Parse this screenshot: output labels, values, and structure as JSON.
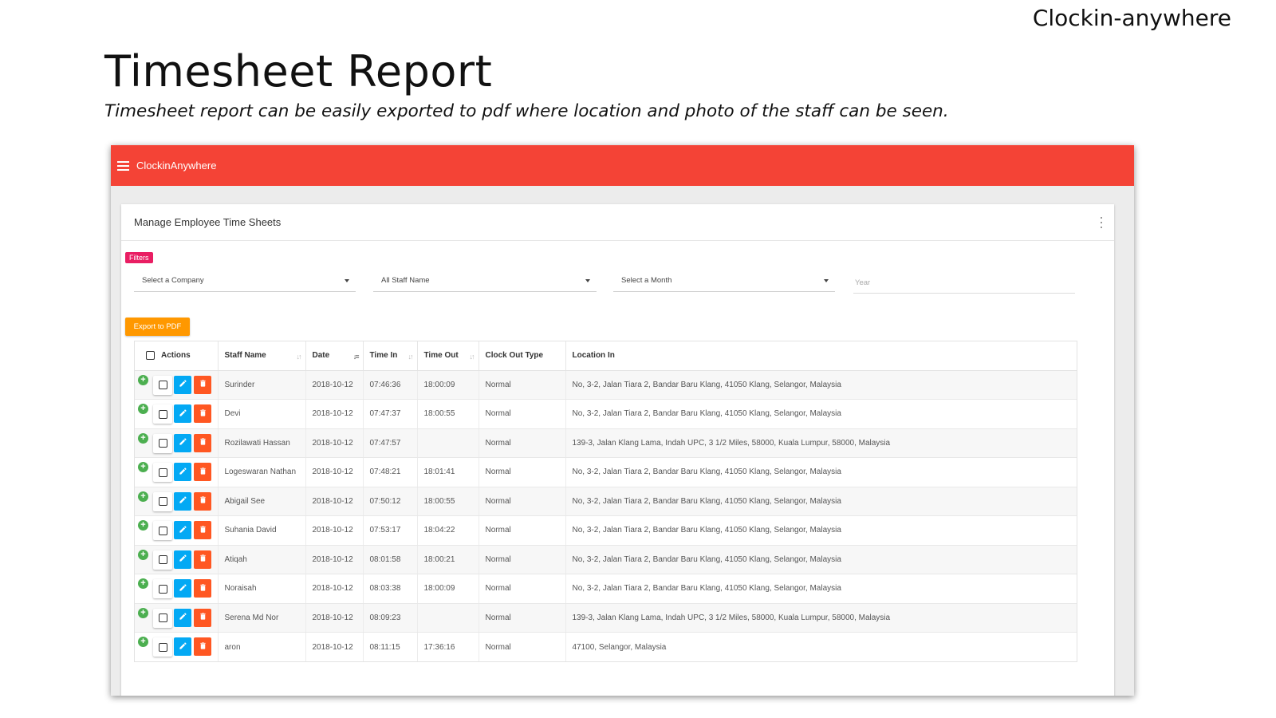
{
  "slide": {
    "brand": "Clockin-anywhere",
    "title": "Timesheet Report",
    "subtitle": "Timesheet report can be easily exported to pdf where location and photo of the staff can be seen."
  },
  "app": {
    "name": "ClockinAnywhere",
    "primary_color": "#f44336",
    "card_title": "Manage Employee Time Sheets",
    "filters_label": "Filters",
    "filters": {
      "company": "Select a Company",
      "staff": "All Staff Name",
      "month": "Select a Month",
      "year_placeholder": "Year"
    },
    "export_label": "Export to PDF",
    "table": {
      "headers": {
        "actions": "Actions",
        "staff_name": "Staff Name",
        "date": "Date",
        "time_in": "Time In",
        "time_out": "Time Out",
        "clock_out_type": "Clock Out Type",
        "location_in": "Location In"
      },
      "rows": [
        {
          "staff": "Surinder",
          "date": "2018-10-12",
          "time_in": "07:46:36",
          "time_out": "18:00:09",
          "type": "Normal",
          "location": "No, 3-2, Jalan Tiara 2, Bandar Baru Klang, 41050 Klang, Selangor, Malaysia"
        },
        {
          "staff": "Devi",
          "date": "2018-10-12",
          "time_in": "07:47:37",
          "time_out": "18:00:55",
          "type": "Normal",
          "location": "No, 3-2, Jalan Tiara 2, Bandar Baru Klang, 41050 Klang, Selangor, Malaysia"
        },
        {
          "staff": "Rozilawati Hassan",
          "date": "2018-10-12",
          "time_in": "07:47:57",
          "time_out": "",
          "type": "Normal",
          "location": "139-3, Jalan Klang Lama, Indah UPC, 3 1/2 Miles, 58000, Kuala Lumpur, 58000, Malaysia"
        },
        {
          "staff": "Logeswaran Nathan",
          "date": "2018-10-12",
          "time_in": "07:48:21",
          "time_out": "18:01:41",
          "type": "Normal",
          "location": "No, 3-2, Jalan Tiara 2, Bandar Baru Klang, 41050 Klang, Selangor, Malaysia"
        },
        {
          "staff": "Abigail See",
          "date": "2018-10-12",
          "time_in": "07:50:12",
          "time_out": "18:00:55",
          "type": "Normal",
          "location": "No, 3-2, Jalan Tiara 2, Bandar Baru Klang, 41050 Klang, Selangor, Malaysia"
        },
        {
          "staff": "Suhania David",
          "date": "2018-10-12",
          "time_in": "07:53:17",
          "time_out": "18:04:22",
          "type": "Normal",
          "location": "No, 3-2, Jalan Tiara 2, Bandar Baru Klang, 41050 Klang, Selangor, Malaysia"
        },
        {
          "staff": "Atiqah",
          "date": "2018-10-12",
          "time_in": "08:01:58",
          "time_out": "18:00:21",
          "type": "Normal",
          "location": "No, 3-2, Jalan Tiara 2, Bandar Baru Klang, 41050 Klang, Selangor, Malaysia"
        },
        {
          "staff": "Noraisah",
          "date": "2018-10-12",
          "time_in": "08:03:38",
          "time_out": "18:00:09",
          "type": "Normal",
          "location": "No, 3-2, Jalan Tiara 2, Bandar Baru Klang, 41050 Klang, Selangor, Malaysia"
        },
        {
          "staff": "Serena Md Nor",
          "date": "2018-10-12",
          "time_in": "08:09:23",
          "time_out": "",
          "type": "Normal",
          "location": "139-3, Jalan Klang Lama, Indah UPC, 3 1/2 Miles, 58000, Kuala Lumpur, 58000, Malaysia"
        },
        {
          "staff": "aron",
          "date": "2018-10-12",
          "time_in": "08:11:15",
          "time_out": "17:36:16",
          "type": "Normal",
          "location": "47100, Selangor, Malaysia"
        }
      ]
    }
  }
}
